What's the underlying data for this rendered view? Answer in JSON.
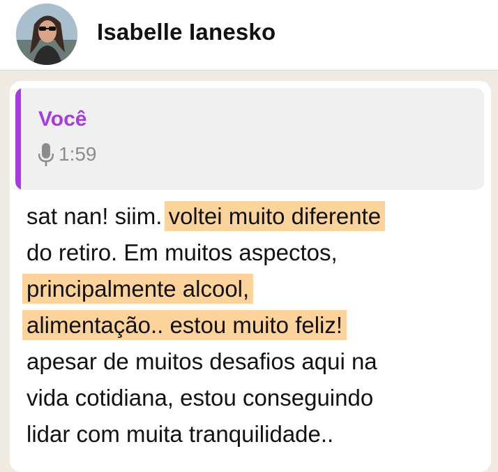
{
  "header": {
    "contact_name": "Isabelle Ianesko"
  },
  "message": {
    "quoted": {
      "author": "Você",
      "icon": "microphone-icon",
      "duration": "1:59"
    },
    "lines": [
      {
        "plain": "sat nan! siim. ",
        "highlight": "voltei muito diferente"
      },
      {
        "plain": "do retiro. Em muitos aspectos,",
        "highlight": ""
      },
      {
        "plain": "",
        "highlight": "principalmente alcool, "
      },
      {
        "plain": "",
        "highlight": "alimentação.. estou muito feliz!"
      },
      {
        "plain": "apesar de muitos desafios aqui na",
        "highlight": ""
      },
      {
        "plain": "vida cotidiana, estou conseguindo",
        "highlight": ""
      },
      {
        "plain": "lidar com muita tranquilidade..",
        "highlight": ""
      }
    ]
  },
  "colors": {
    "quote_accent": "#a53be0",
    "highlight": "#fbd39b",
    "chat_background": "#efeae2"
  }
}
